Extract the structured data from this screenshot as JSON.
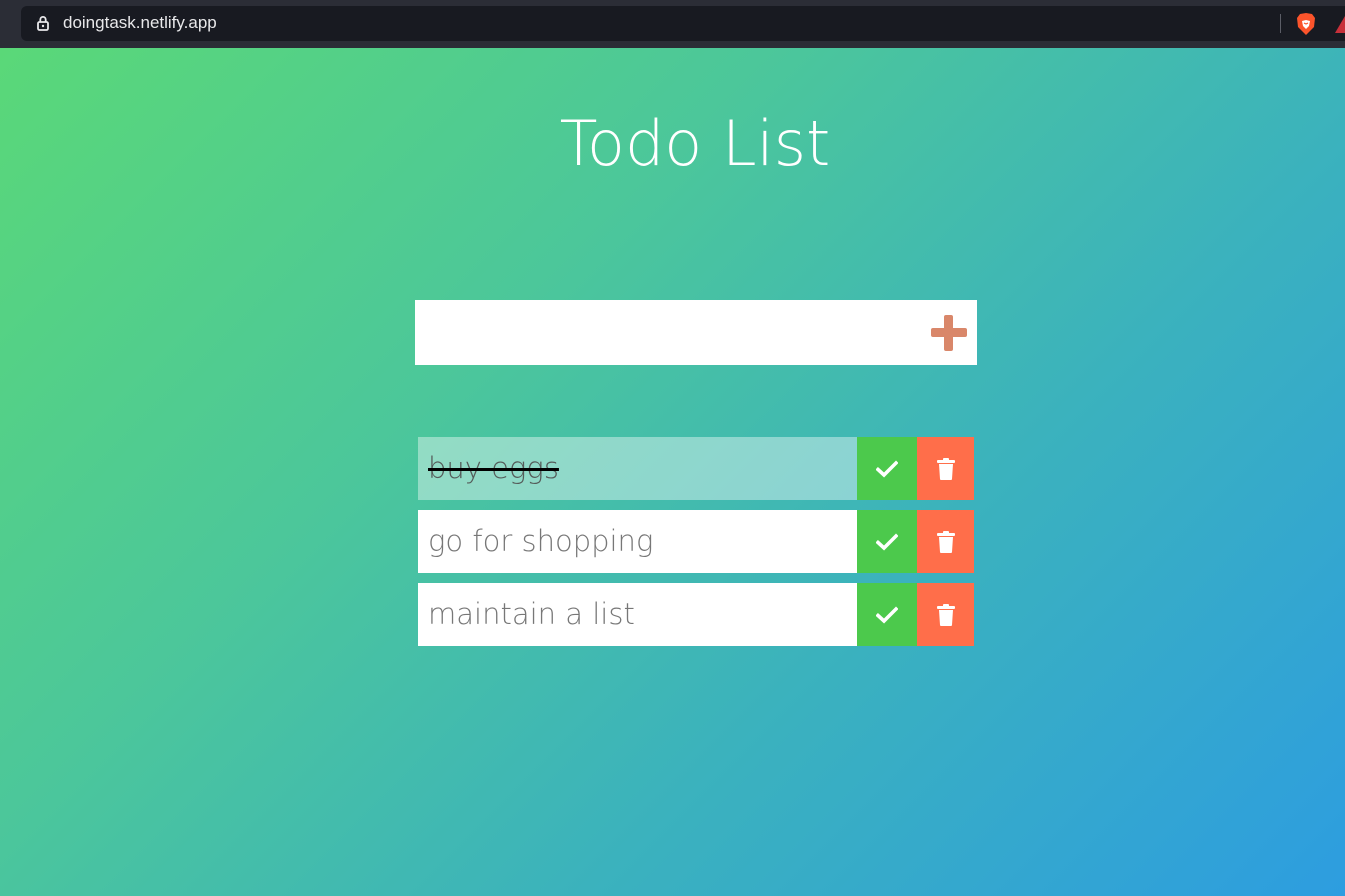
{
  "browser": {
    "url": "doingtask.netlify.app",
    "icons": [
      "lock-icon",
      "brave-lion-icon",
      "brave-rewards-icon"
    ]
  },
  "page": {
    "title": "Todo List",
    "add_form": {
      "input_value": "",
      "icon": "plus-icon"
    },
    "todos": [
      {
        "text": "buy eggs",
        "completed": true
      },
      {
        "text": "go for shopping",
        "completed": false
      },
      {
        "text": "maintain a list",
        "completed": false
      }
    ],
    "item_icons": {
      "complete": "check-icon",
      "delete": "trash-icon"
    }
  },
  "colors": {
    "gradient_start": "#5ad878",
    "gradient_end": "#2d9de0",
    "complete_button": "#4cc94c",
    "delete_button": "#ff6e4a",
    "add_icon": "#d9876a"
  }
}
